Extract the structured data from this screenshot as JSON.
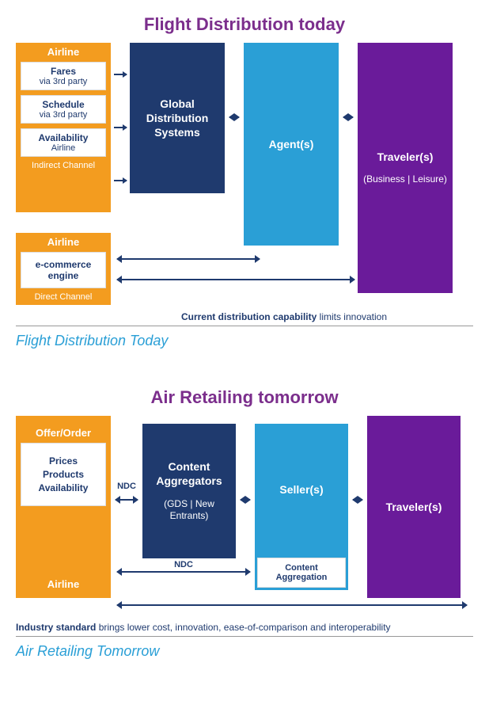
{
  "diagram1": {
    "title": "Flight Distribution today",
    "caption": "Flight Distribution Today",
    "footnote_bold": "Current distribution capability",
    "footnote_rest": " limits innovation",
    "airline_top": {
      "header": "Airline",
      "fares_title": "Fares",
      "fares_sub": "via 3rd party",
      "schedule_title": "Schedule",
      "schedule_sub": "via 3rd party",
      "avail_title": "Availability",
      "avail_sub": "Airline",
      "channel": "Indirect Channel"
    },
    "airline_bottom": {
      "header": "Airline",
      "ecom_title": "e-commerce engine",
      "channel": "Direct Channel"
    },
    "gds": "Global Distribution Systems",
    "agents": "Agent(s)",
    "travelers": "Traveler(s)",
    "travelers_sub": "(Business | Leisure)"
  },
  "diagram2": {
    "title": "Air Retailing tomorrow",
    "caption": "Air Retailing Tomorrow",
    "footnote_bold": "Industry standard",
    "footnote_rest": " brings lower cost, innovation, ease-of-comparison and interoperability",
    "airline": {
      "header": "Offer/Order",
      "body_l1": "Prices",
      "body_l2": "Products",
      "body_l3": "Availability",
      "footer": "Airline"
    },
    "aggregators_title": "Content Aggregators",
    "aggregators_sub": "(GDS | New Entrants)",
    "sellers": "Seller(s)",
    "sellers_sub": "Content Aggregation",
    "travelers": "Traveler(s)",
    "ndc": "NDC"
  }
}
